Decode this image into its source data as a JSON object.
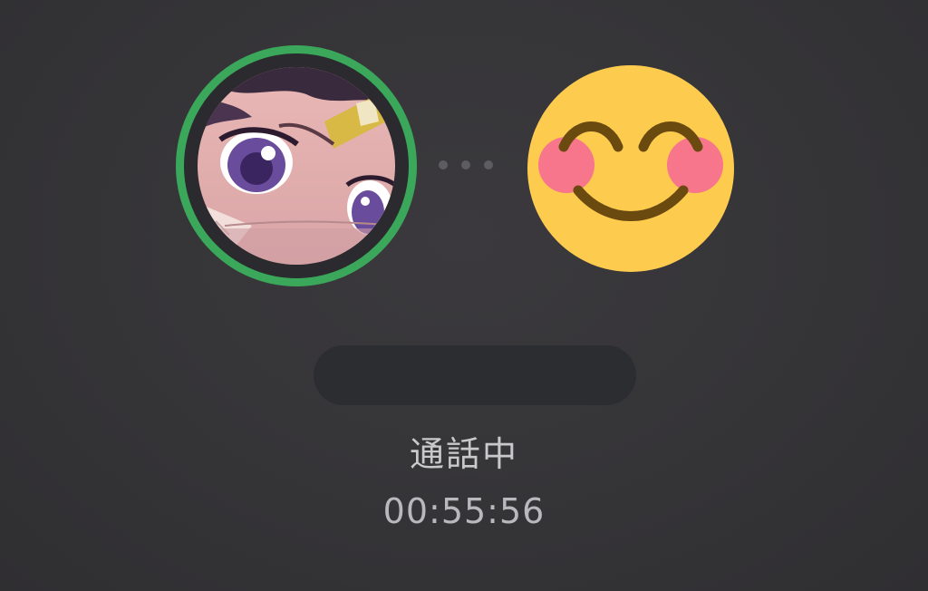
{
  "call": {
    "status": "通話中",
    "duration": "00:55:56",
    "caller_avatar": {
      "icon": "anime-character-avatar",
      "ring_color": "#3aa75b"
    },
    "contact_avatar": {
      "icon": "smiling-face-with-blushing-cheeks-emoji"
    },
    "contact_name": ""
  },
  "colors": {
    "background": "#363538",
    "ring": "#3aa75b",
    "name_pill": "#2b2d31",
    "text": "#c9c9cc"
  }
}
